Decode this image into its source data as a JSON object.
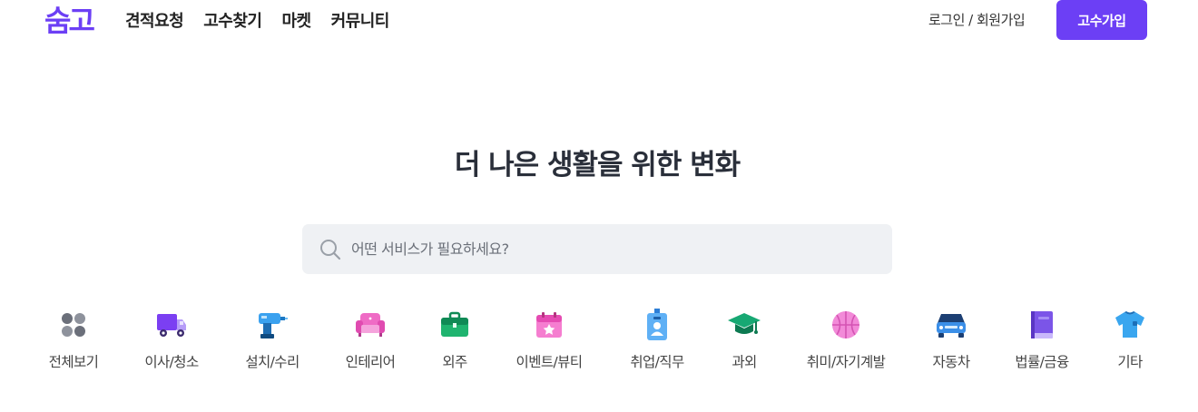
{
  "header": {
    "logo_text": "숨고",
    "nav": [
      "견적요청",
      "고수찾기",
      "마켓",
      "커뮤니티"
    ],
    "login": "로그인 / 회원가입",
    "pro_button": "고수가입"
  },
  "hero": {
    "title": "더 나은 생활을 위한 변화"
  },
  "search": {
    "placeholder": "어떤 서비스가 필요하세요?",
    "value": ""
  },
  "categories": [
    {
      "label": "전체보기",
      "icon": "grid-dots-icon"
    },
    {
      "label": "이사/청소",
      "icon": "moving-truck-icon"
    },
    {
      "label": "설치/수리",
      "icon": "drill-icon"
    },
    {
      "label": "인테리어",
      "icon": "sofa-icon"
    },
    {
      "label": "외주",
      "icon": "briefcase-icon"
    },
    {
      "label": "이벤트/뷰티",
      "icon": "calendar-star-icon"
    },
    {
      "label": "취업/직무",
      "icon": "id-badge-icon"
    },
    {
      "label": "과외",
      "icon": "graduation-cap-icon"
    },
    {
      "label": "취미/자기계발",
      "icon": "basketball-icon"
    },
    {
      "label": "자동차",
      "icon": "car-icon"
    },
    {
      "label": "법률/금융",
      "icon": "book-icon"
    },
    {
      "label": "기타",
      "icon": "shirt-icon"
    }
  ],
  "colors": {
    "brand": "#6c3ff5",
    "search_bg": "#eff1f4",
    "title": "#2a2f3a"
  }
}
